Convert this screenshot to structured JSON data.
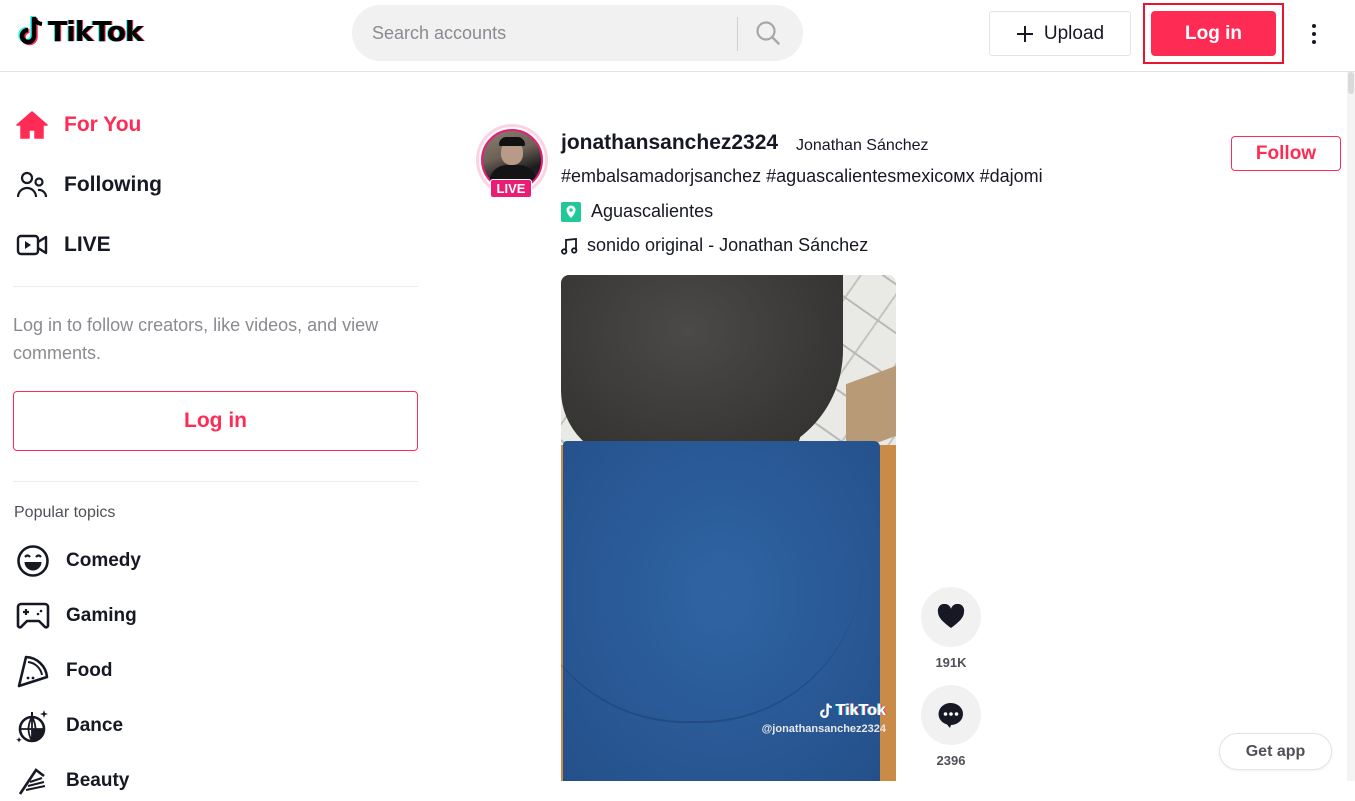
{
  "header": {
    "logo_text": "TikTok",
    "search": {
      "placeholder": "Search accounts",
      "value": ""
    },
    "upload_label": "Upload",
    "login_label": "Log in",
    "colors": {
      "brand": "#fe2c55",
      "highlight_border": "#e5162e"
    }
  },
  "sidebar": {
    "nav": [
      {
        "label": "For You",
        "icon": "home-icon",
        "active": true
      },
      {
        "label": "Following",
        "icon": "users-icon",
        "active": false
      },
      {
        "label": "LIVE",
        "icon": "live-video-icon",
        "active": false
      }
    ],
    "login_hint": "Log in to follow creators, like videos, and view comments.",
    "login_label": "Log in",
    "topics_title": "Popular topics",
    "topics": [
      {
        "label": "Comedy",
        "icon": "laughing-face-icon"
      },
      {
        "label": "Gaming",
        "icon": "gamepad-icon"
      },
      {
        "label": "Food",
        "icon": "pizza-slice-icon"
      },
      {
        "label": "Dance",
        "icon": "disco-ball-icon"
      },
      {
        "label": "Beauty",
        "icon": "comb-icon"
      }
    ]
  },
  "post": {
    "username": "jonathansanchez2324",
    "display_name": "Jonathan Sánchez",
    "live_badge": "LIVE",
    "follow_label": "Follow",
    "hashtags": [
      "#embalsamadorjsanchez",
      "#aguascalientesmexicoмх",
      "#dajomi"
    ],
    "location": "Aguascalientes",
    "music": "sonido original - Jonathan Sánchez",
    "watermark_logo": "TikTok",
    "watermark_user": "@jonathansanchez2324",
    "likes": "191K",
    "comments": "2396"
  },
  "get_app_label": "Get app"
}
